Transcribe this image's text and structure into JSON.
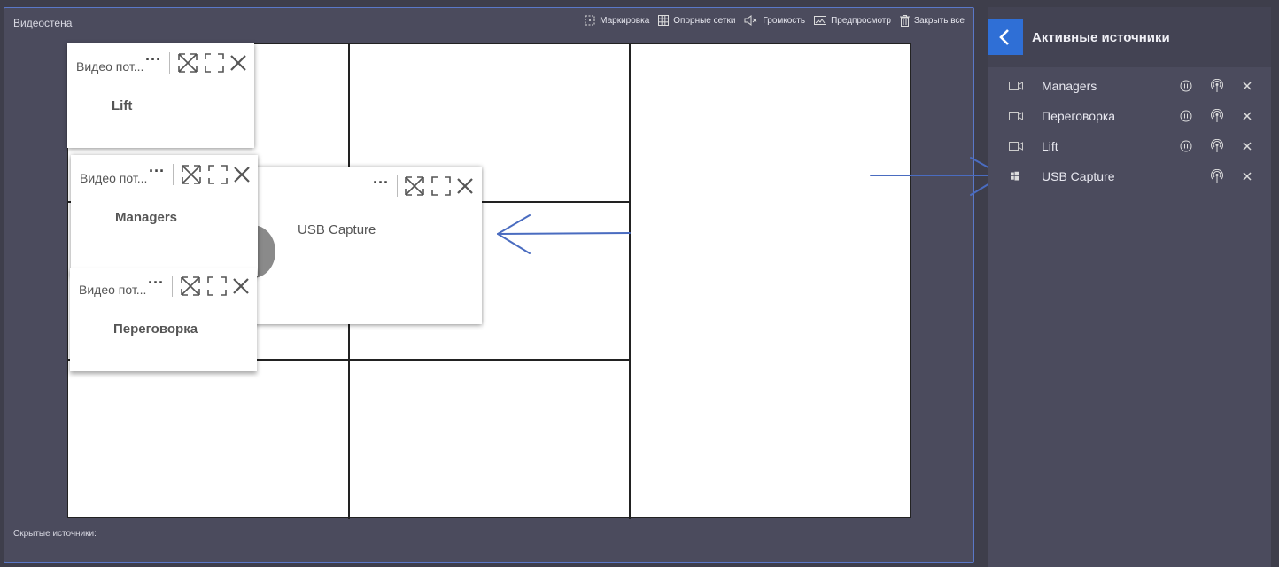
{
  "wall": {
    "title": "Видеостена",
    "hidden_sources_label": "Скрытые источники:",
    "toolbar": {
      "marking": "Маркировка",
      "grids": "Опорные сетки",
      "volume": "Громкость",
      "preview": "Предпросмотр",
      "close_all": "Закрыть все"
    },
    "windows": [
      {
        "type": "Видео пот...",
        "name": "Lift"
      },
      {
        "type": "Видео пот...",
        "name": "Managers"
      },
      {
        "type": "",
        "name": "USB Capture"
      },
      {
        "type": "Видео пот...",
        "name": "Переговорка"
      }
    ]
  },
  "sidebar": {
    "title": "Активные источники",
    "sources": [
      {
        "name": "Managers",
        "icon": "camera-icon"
      },
      {
        "name": "Переговорка",
        "icon": "camera-icon"
      },
      {
        "name": "Lift",
        "icon": "camera-icon"
      },
      {
        "name": "USB Capture",
        "icon": "windows-icon"
      }
    ]
  },
  "colors": {
    "accent": "#2f6fd6",
    "panel": "#4b4b5d",
    "annotation_arrow": "#4a6cc0"
  }
}
